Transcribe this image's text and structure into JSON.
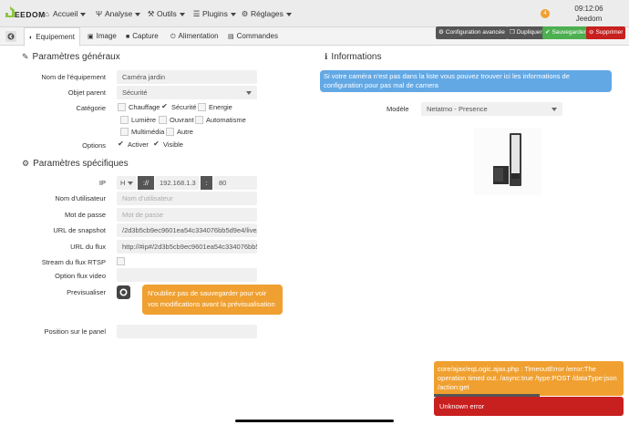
{
  "navbar": {
    "logo_text": "EEDOM",
    "items": [
      {
        "label": "Accueil",
        "icon": "home-icon"
      },
      {
        "label": "Analyse",
        "icon": "dashboard-icon"
      },
      {
        "label": "Outils",
        "icon": "wrench-icon"
      },
      {
        "label": "Plugins",
        "icon": "tasks-icon"
      },
      {
        "label": "Réglages",
        "icon": "gears-icon"
      }
    ],
    "notification_count": "4",
    "time": "09:12:06",
    "hostname": "Jeedom"
  },
  "tabs": [
    {
      "label": "Equipement",
      "icon": "tachometer-icon",
      "active": true
    },
    {
      "label": "Image",
      "icon": "image-icon"
    },
    {
      "label": "Capture",
      "icon": "video-icon"
    },
    {
      "label": "Alimentation",
      "icon": "power-icon"
    },
    {
      "label": "Commandes",
      "icon": "list-icon"
    }
  ],
  "actions": {
    "config": "Configuration avancée",
    "duplicate": "Dupliquer",
    "save": "Sauvegarder",
    "delete": "Supprimer"
  },
  "general": {
    "title": "Paramètres généraux",
    "name_label": "Nom de l'équipement",
    "name_value": "Caméra jardin",
    "parent_label": "Objet parent",
    "parent_value": "Sécurité",
    "category_label": "Catégorie",
    "categories": [
      {
        "label": "Chauffage",
        "checked": false
      },
      {
        "label": "Sécurité",
        "checked": true
      },
      {
        "label": "Energie",
        "checked": false
      },
      {
        "label": "Lumière",
        "checked": false
      },
      {
        "label": "Ouvrant",
        "checked": false
      },
      {
        "label": "Automatisme",
        "checked": false
      },
      {
        "label": "Multimédia",
        "checked": false
      },
      {
        "label": "Autre",
        "checked": false
      }
    ],
    "options_label": "Options",
    "options": [
      {
        "label": "Activer",
        "checked": true
      },
      {
        "label": "Visible",
        "checked": true
      }
    ]
  },
  "specific": {
    "title": "Paramètres spécifiques",
    "ip_label": "IP",
    "protocol": "H",
    "separator": "://",
    "ip_value": "192.168.1.3",
    "port_separator": ":",
    "port_value": "80",
    "user_label": "Nom d'utilisateur",
    "user_placeholder": "Nom d'utilisateur",
    "password_label": "Mot de passe",
    "password_placeholder": "Mot de passe",
    "snapshot_label": "URL de snapshot",
    "snapshot_value": "/2d3b5cb9ec9601ea54c334076bb5d9e4/live/",
    "stream_label": "URL du flux",
    "stream_value": "http://#ip#/2d3b5cb9ec9601ea54c334076bb5",
    "rtsp_label": "Stream du flux RTSP",
    "video_option_label": "Option flux video",
    "preview_label": "Previsualiser",
    "preview_alert": "N'oubliez pas de sauvegarder pour voir vos modifications avant la prévisualisation",
    "panel_label": "Position sur le panel"
  },
  "info": {
    "title": "Informations",
    "alert_text": "Si votre caméra n'est pas dans la liste vous pouvez trouver ici les informations de configuration pour pas mal de camera",
    "model_label": "Modèle",
    "model_value": "Netatmo - Presence"
  },
  "notifications": {
    "timeout": "core/ajax/eqLogic.ajax.php : TimeoutError /error:The operation timed out. /async:true /type:POST /dataType:json /action:get",
    "unknown": "Unknown error"
  },
  "colors": {
    "info_blue": "#62a8e5",
    "warning_orange": "#f0a030",
    "danger_red": "#c81f1f",
    "success_green": "#4caf50"
  }
}
